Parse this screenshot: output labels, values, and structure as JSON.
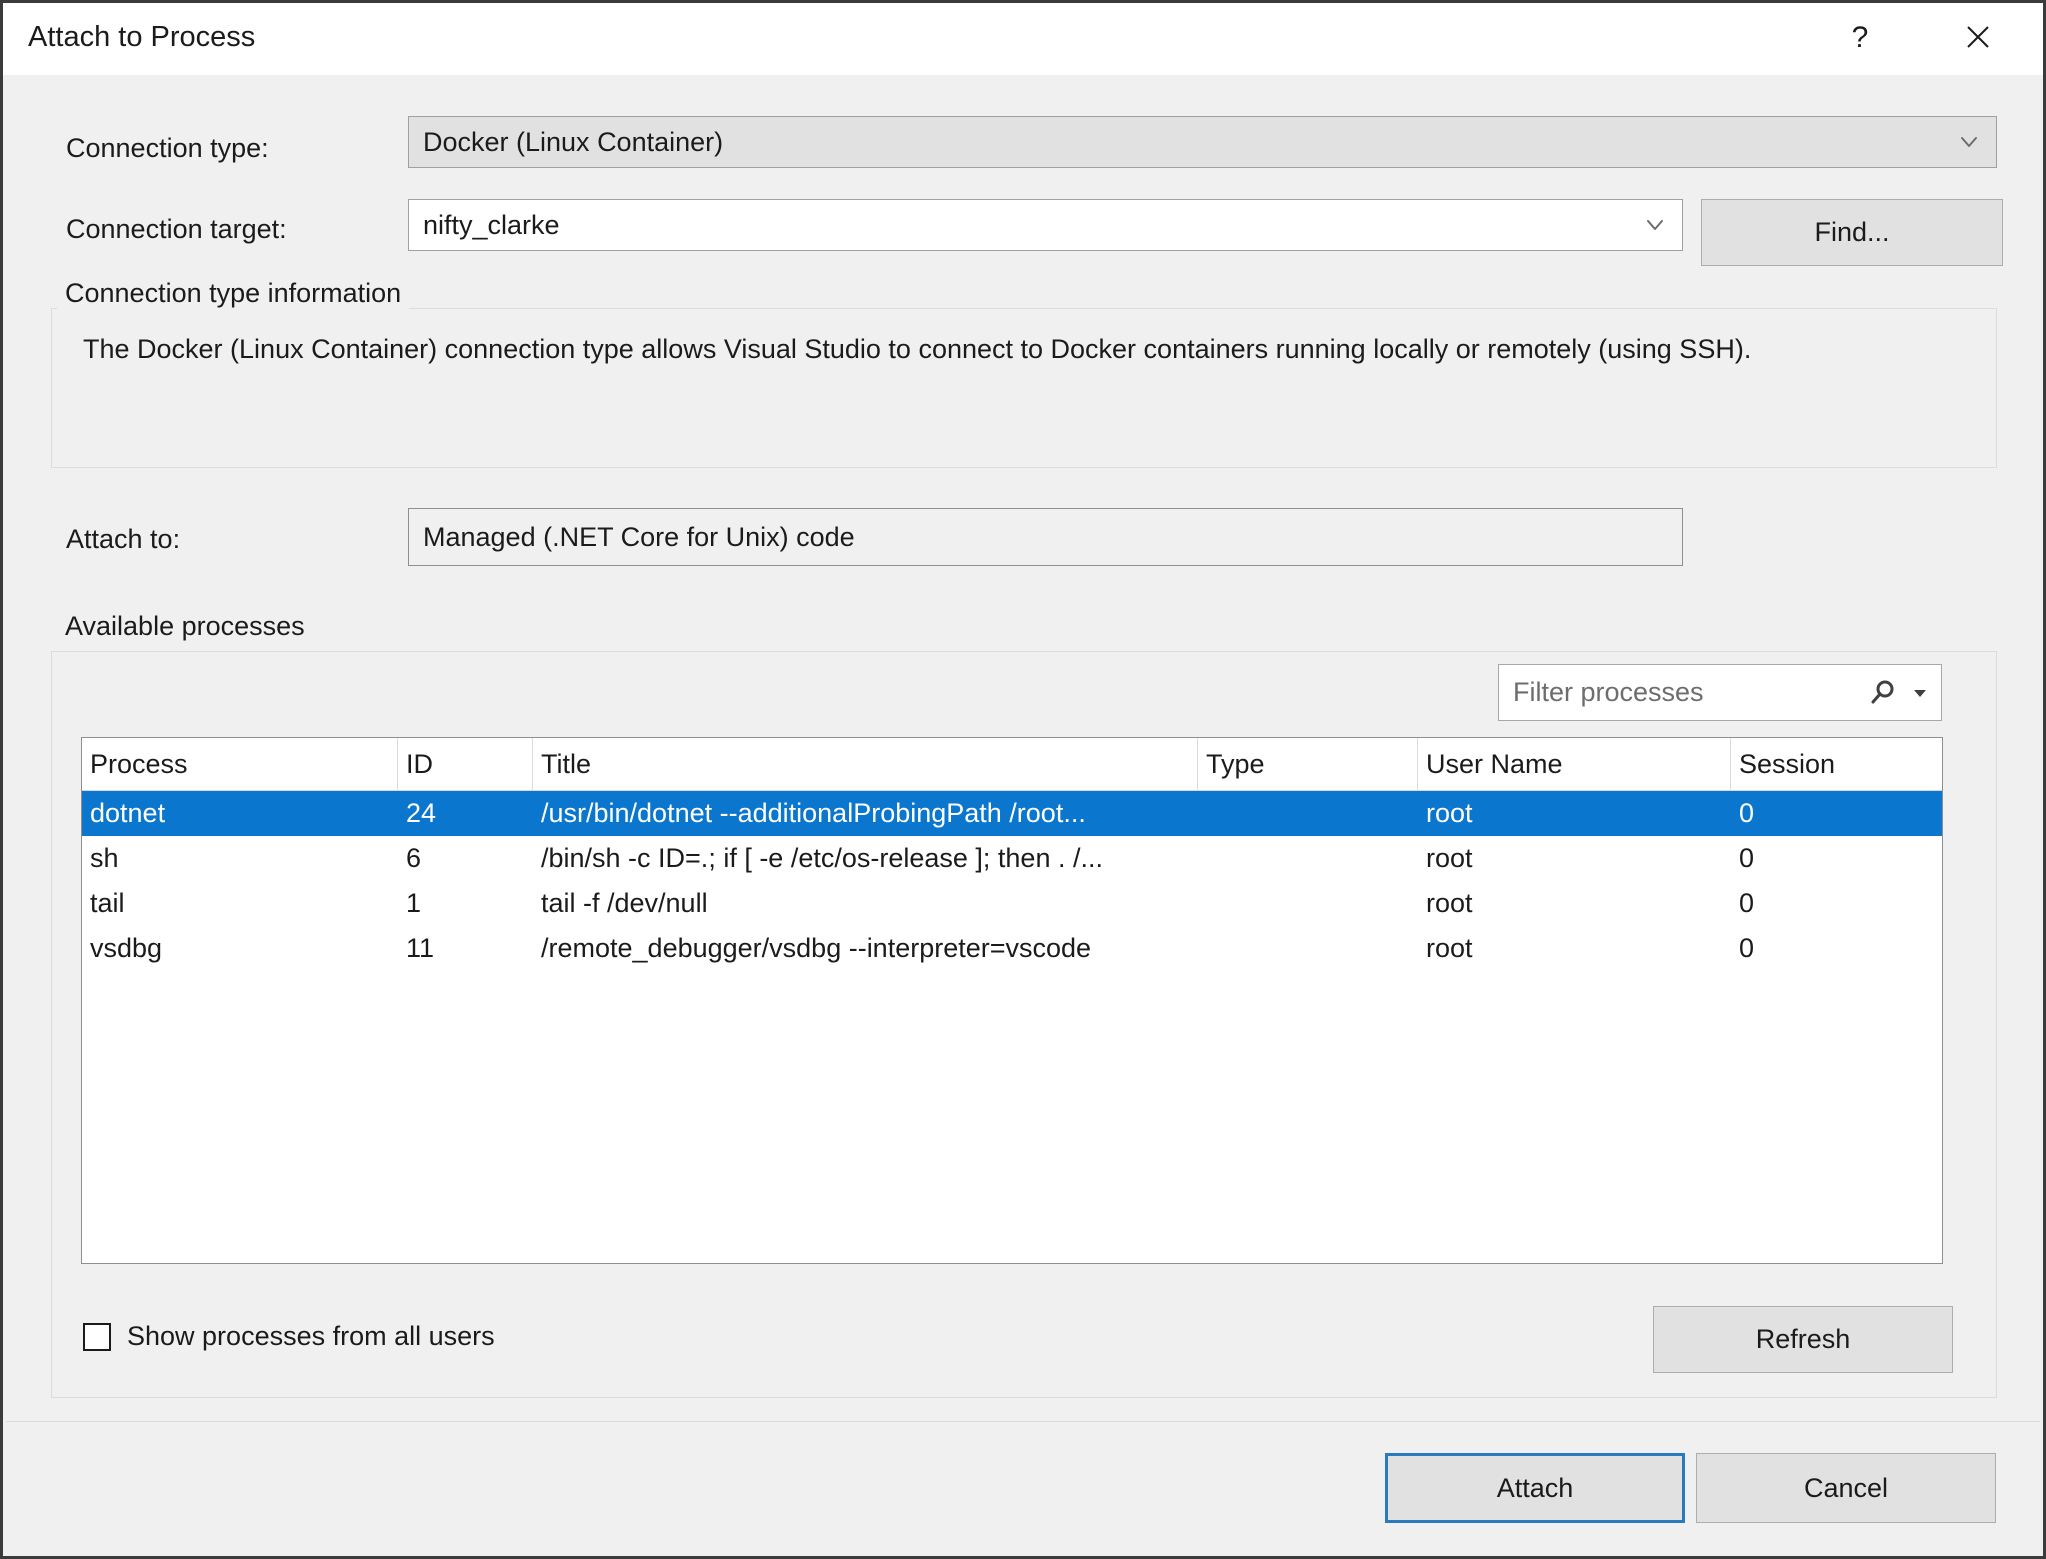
{
  "window": {
    "title": "Attach to Process",
    "help_icon": "question-mark-icon",
    "close_icon": "close-icon"
  },
  "connection": {
    "type_label": "Connection type:",
    "type_value": "Docker (Linux Container)",
    "target_label": "Connection target:",
    "target_value": "nifty_clarke",
    "find_label": "Find..."
  },
  "info_group": {
    "legend": "Connection type information",
    "text": "The Docker (Linux Container) connection type allows Visual Studio to connect to Docker containers running locally or remotely (using SSH)."
  },
  "attach_to": {
    "label": "Attach to:",
    "value": "Managed (.NET Core for Unix) code"
  },
  "processes_group": {
    "legend": "Available processes",
    "filter_placeholder": "Filter processes",
    "search_icon": "magnifier-icon",
    "filter_caret_icon": "chevron-down-icon",
    "columns": [
      "Process",
      "ID",
      "Title",
      "Type",
      "User Name",
      "Session"
    ],
    "rows": [
      {
        "process": "dotnet",
        "id": "24",
        "title": "/usr/bin/dotnet --additionalProbingPath /root...",
        "type": "",
        "user_name": "root",
        "session": "0",
        "selected": true
      },
      {
        "process": "sh",
        "id": "6",
        "title": "/bin/sh -c ID=.; if [ -e /etc/os-release ]; then . /...",
        "type": "",
        "user_name": "root",
        "session": "0",
        "selected": false
      },
      {
        "process": "tail",
        "id": "1",
        "title": "tail -f /dev/null",
        "type": "",
        "user_name": "root",
        "session": "0",
        "selected": false
      },
      {
        "process": "vsdbg",
        "id": "11",
        "title": "/remote_debugger/vsdbg --interpreter=vscode",
        "type": "",
        "user_name": "root",
        "session": "0",
        "selected": false
      }
    ],
    "show_all_users_label": "Show processes from all users",
    "show_all_users_checked": false,
    "refresh_label": "Refresh"
  },
  "footer": {
    "attach_label": "Attach",
    "cancel_label": "Cancel"
  },
  "colors": {
    "selection_blue": "#0a76cd",
    "focus_blue": "#2a7bbd",
    "dialog_bg": "#f0f0f0",
    "control_gray": "#e1e1e1"
  }
}
